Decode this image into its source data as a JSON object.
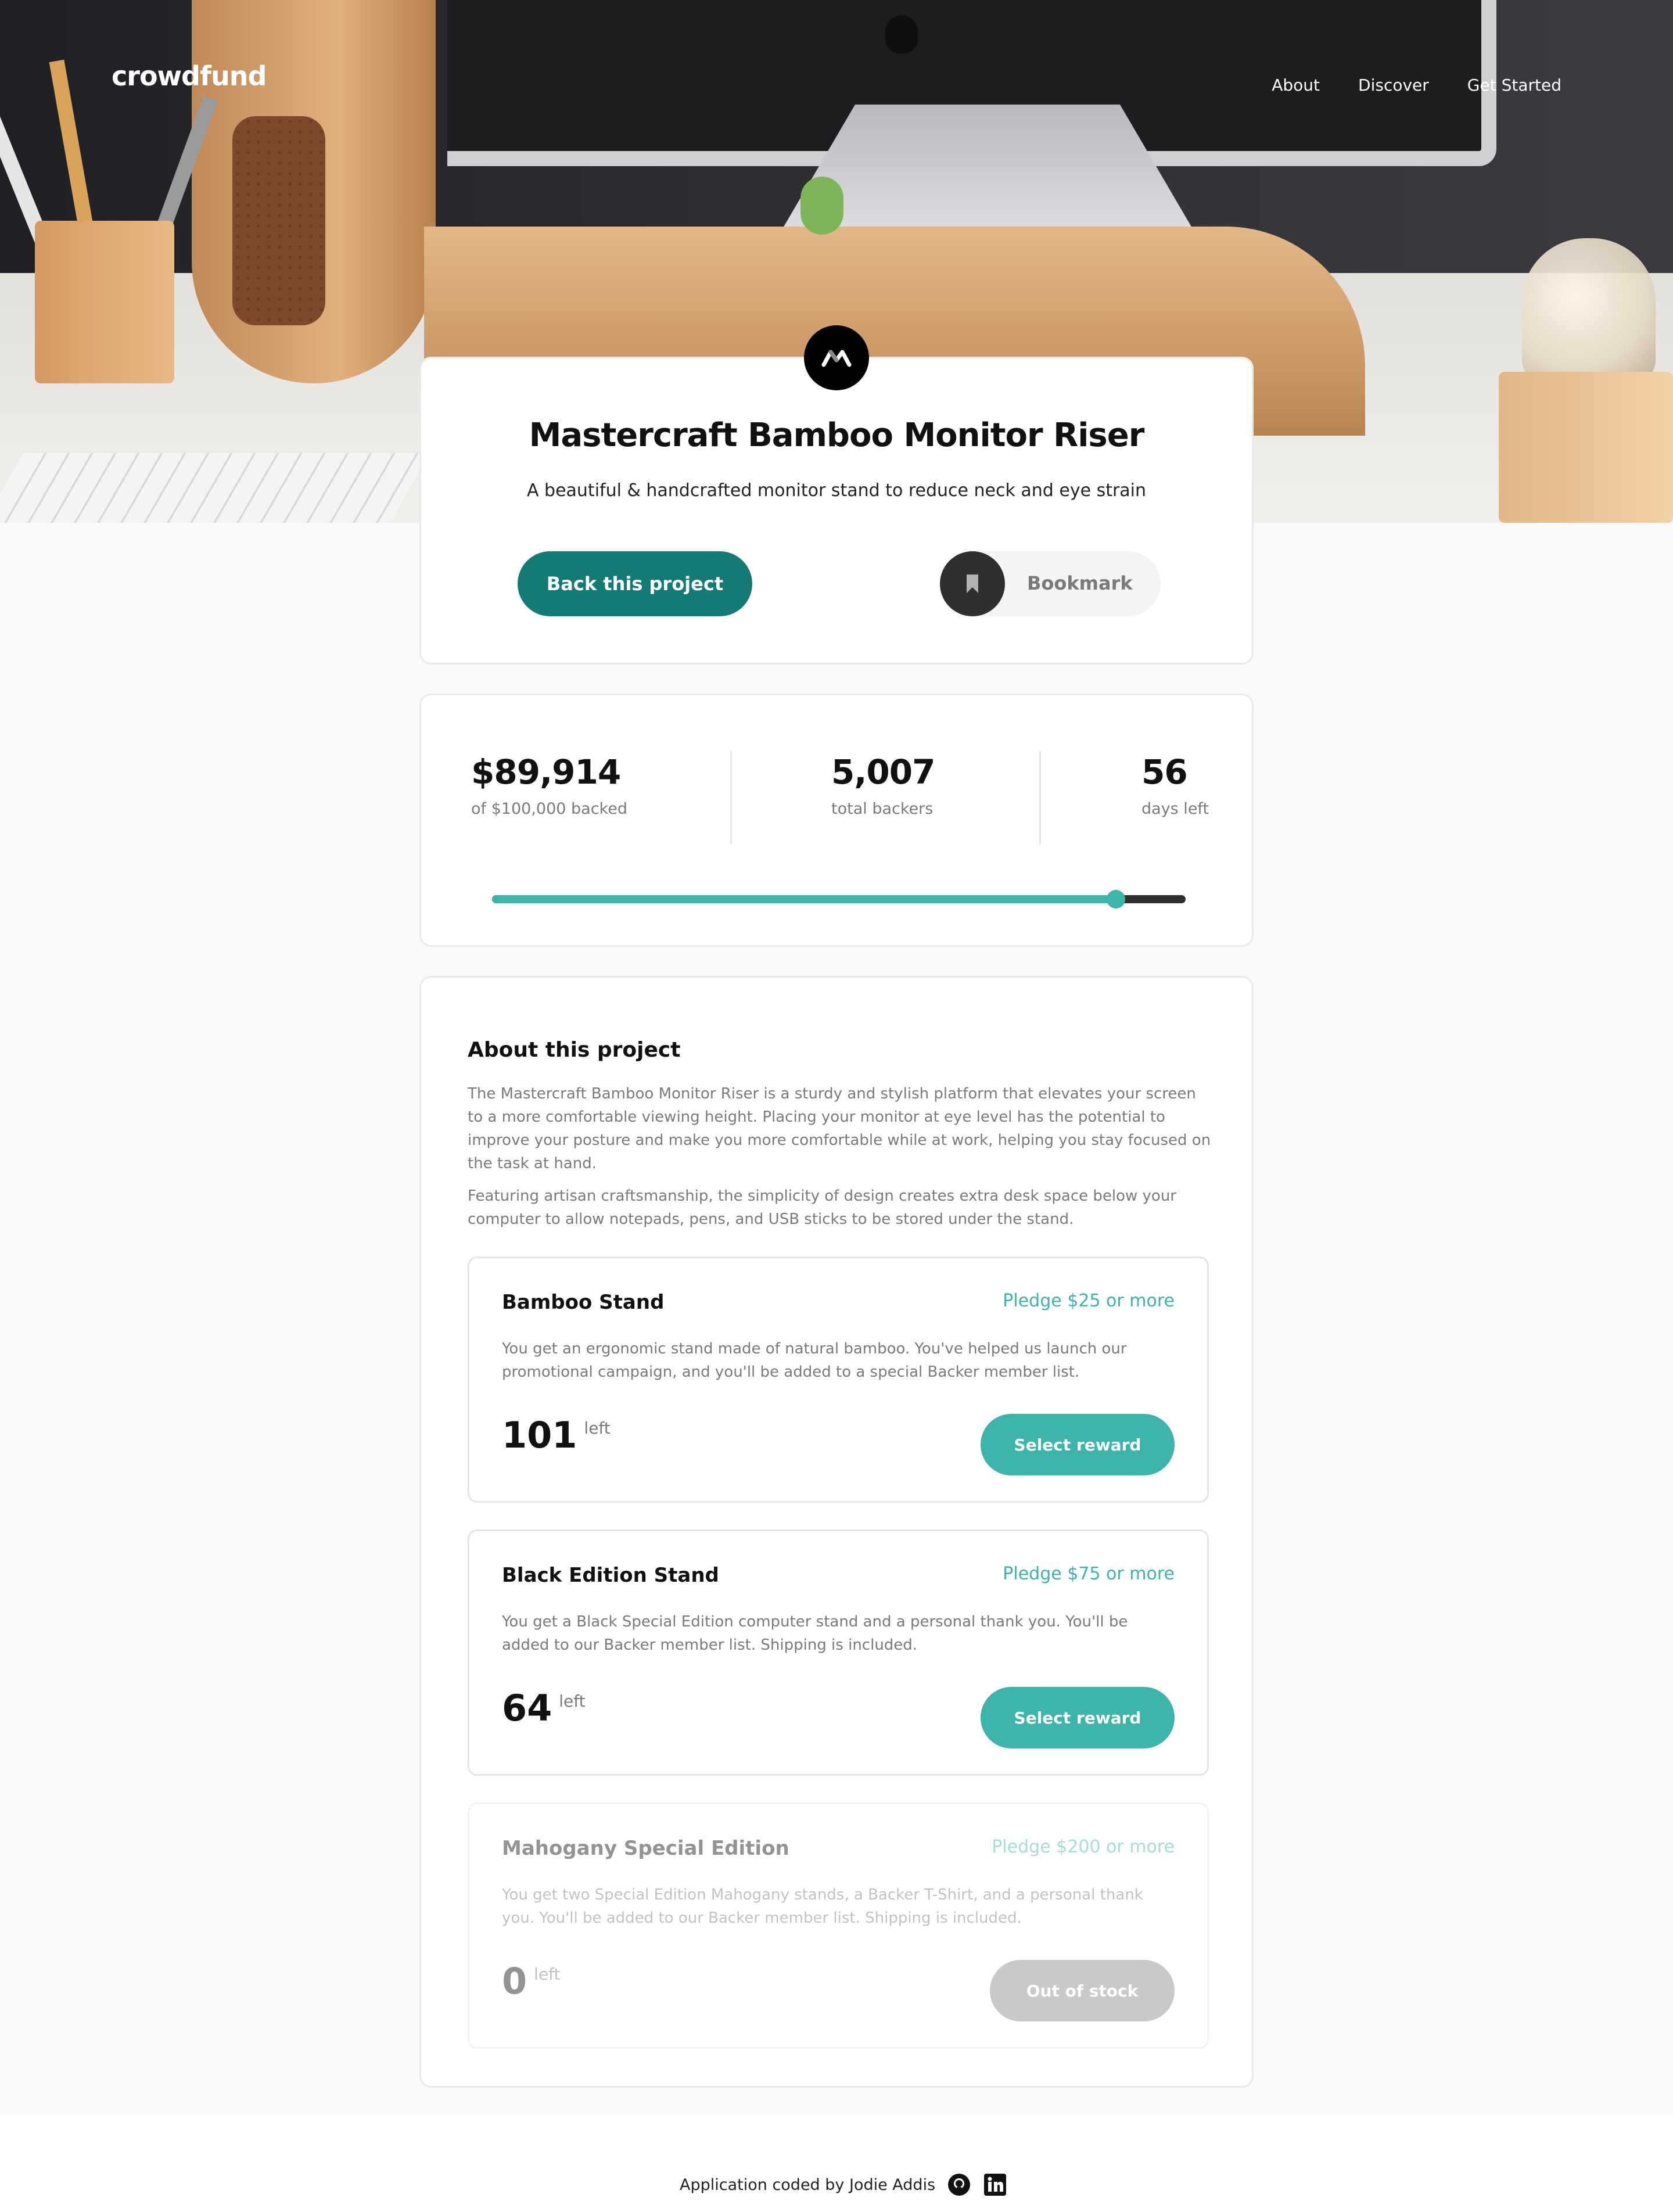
{
  "header": {
    "logo": "crowdfund",
    "nav": [
      "About",
      "Discover",
      "Get Started"
    ]
  },
  "project": {
    "logo_icon": "mastercraft-logo-icon",
    "title": "Mastercraft Bamboo Monitor Riser",
    "subtitle": "A beautiful & handcrafted monitor stand to reduce neck and eye strain",
    "back_label": "Back this project",
    "bookmark_label": "Bookmark",
    "bookmark_icon": "bookmark-icon"
  },
  "stats": {
    "backed_amount": "$89,914",
    "backed_label": "of $100,000 backed",
    "backers": "5,007",
    "backers_label": "total backers",
    "days": "56",
    "days_label": "days left",
    "progress": 0.89914
  },
  "about": {
    "heading": "About this project",
    "p1": "The Mastercraft Bamboo Monitor Riser is a sturdy and stylish platform that elevates your screen to a more comfortable viewing height. Placing your monitor at eye level has the potential to improve your posture and make you more comfortable while at work, helping you stay focused on the task at hand.",
    "p2": "Featuring artisan craftsmanship, the simplicity of design creates extra desk space below your computer to allow notepads, pens, and USB sticks to be stored under the stand."
  },
  "rewards": [
    {
      "name": "Bamboo Stand",
      "pledge": "Pledge $25 or more",
      "desc": "You get an ergonomic stand made of natural bamboo. You've helped us launch our promotional campaign, and you'll be added to a special Backer member list.",
      "left": "101",
      "left_label": "left",
      "button": "Select reward"
    },
    {
      "name": "Black Edition Stand",
      "pledge": "Pledge $75 or more",
      "desc": "You get a Black Special Edition computer stand and a personal thank you. You'll be added to our Backer member list. Shipping is included.",
      "left": "64",
      "left_label": "left",
      "button": "Select reward"
    },
    {
      "name": "Mahogany Special Edition",
      "pledge": "Pledge $200 or more",
      "desc": "You get two Special Edition Mahogany stands, a Backer T-Shirt, and a personal thank you. You'll be added to our Backer member list. Shipping is included.",
      "left": "0",
      "left_label": "left",
      "button": "Out of stock"
    }
  ],
  "footer": {
    "credit": "Application coded by Jodie Addis",
    "icons": [
      "github-icon",
      "linkedin-icon"
    ]
  },
  "colors": {
    "primary": "#3cb4a9",
    "primary_dark": "#147b74",
    "dark": "#2f2f2f",
    "muted": "#7a7a7a"
  }
}
